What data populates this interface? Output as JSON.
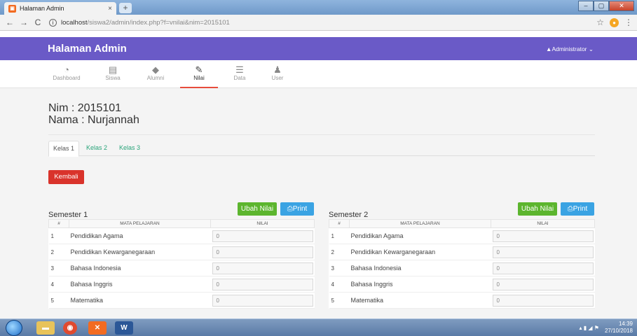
{
  "browser": {
    "tab_title": "Halaman Admin",
    "tab_close": "×",
    "new_tab": "+",
    "url_host": "localhost",
    "url_path": "/siswa2/admin/index.php?f=vnilai&nim=2015101",
    "window_controls": [
      "–",
      "▢",
      "✕"
    ]
  },
  "app": {
    "title": "Halaman Admin",
    "user_menu": "▲Administrator ⌄",
    "nav": [
      {
        "label": "Dashboard",
        "icon": "dashboard-icon"
      },
      {
        "label": "Siswa",
        "icon": "briefcase-icon"
      },
      {
        "label": "Alumni",
        "icon": "tag-icon"
      },
      {
        "label": "Nilai",
        "icon": "edit-icon",
        "active": true
      },
      {
        "label": "Data",
        "icon": "list-icon"
      },
      {
        "label": "User",
        "icon": "user-icon"
      }
    ]
  },
  "student": {
    "nim_line": "Nim   : 2015101",
    "nama_line": "Nama : Nurjannah"
  },
  "kelas_tabs": [
    {
      "label": "Kelas 1",
      "active": true
    },
    {
      "label": "Kelas 2"
    },
    {
      "label": "Kelas 3"
    }
  ],
  "kembali_label": "Kembali",
  "semesters": [
    {
      "title": "Semester 1",
      "edit_label": "Ubah Nilai",
      "print_label": "⎙Print",
      "headers": [
        "#",
        "MATA PELAJARAN",
        "NILAI"
      ],
      "rows": [
        {
          "no": "1",
          "mapel": "Pendidikan Agama",
          "nilai": "0"
        },
        {
          "no": "2",
          "mapel": "Pendidikan Kewarganegaraan",
          "nilai": "0"
        },
        {
          "no": "3",
          "mapel": "Bahasa Indonesia",
          "nilai": "0"
        },
        {
          "no": "4",
          "mapel": "Bahasa Inggris",
          "nilai": "0"
        },
        {
          "no": "5",
          "mapel": "Matematika",
          "nilai": "0"
        }
      ]
    },
    {
      "title": "Semester 2",
      "edit_label": "Ubah Nilai",
      "print_label": "⎙Print",
      "headers": [
        "#",
        "MATA PELAJARAN",
        "NILAI"
      ],
      "rows": [
        {
          "no": "1",
          "mapel": "Pendidikan Agama",
          "nilai": "0"
        },
        {
          "no": "2",
          "mapel": "Pendidikan Kewarganegaraan",
          "nilai": "0"
        },
        {
          "no": "3",
          "mapel": "Bahasa Indonesia",
          "nilai": "0"
        },
        {
          "no": "4",
          "mapel": "Bahasa Inggris",
          "nilai": "0"
        },
        {
          "no": "5",
          "mapel": "Matematika",
          "nilai": "0"
        }
      ]
    }
  ],
  "taskbar": {
    "time": "14:39",
    "date": "27/10/2018"
  },
  "colors": {
    "appbar": "#6a5ac7",
    "kembali": "#d9332b",
    "edit": "#5cb52e",
    "print": "#3aa3e3",
    "tab_link": "#2aa47a"
  }
}
